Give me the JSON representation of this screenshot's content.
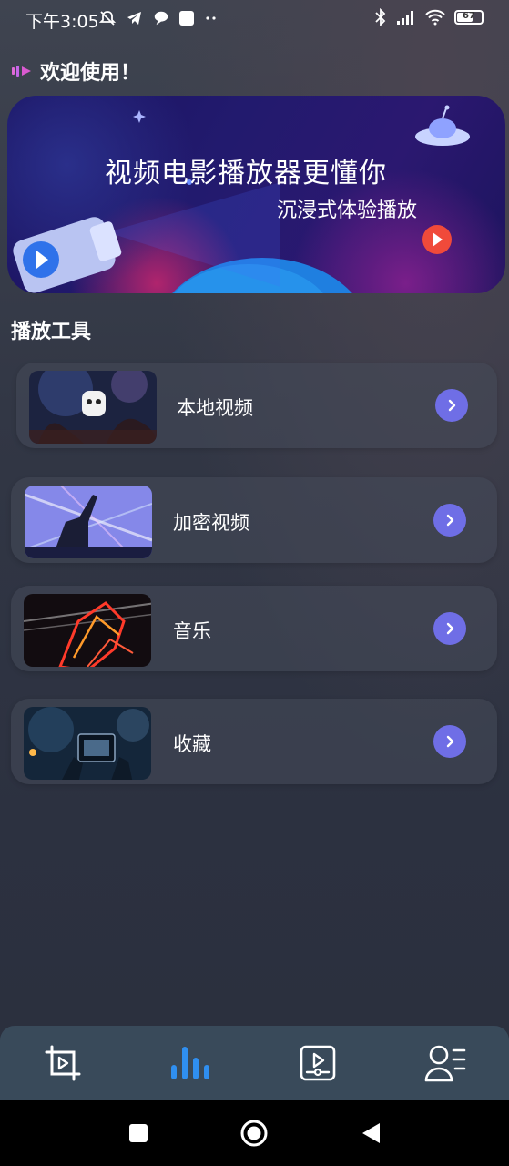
{
  "status_bar": {
    "time": "下午3:05",
    "left_icons": [
      "mute-bell-icon",
      "telegram-icon",
      "chat-icon",
      "square-app-icon",
      "more-dots-icon"
    ],
    "right_icons": [
      "bluetooth-icon",
      "signal-icon",
      "wifi-icon",
      "battery-icon"
    ],
    "battery_level": "67"
  },
  "header": {
    "welcome_text": "欢迎使用！",
    "welcome_icon": "speaker-wave-icon"
  },
  "banner": {
    "title": "视频电影播放器更懂你",
    "subtitle": "沉浸式体验播放"
  },
  "section": {
    "title": "播放工具"
  },
  "tools": [
    {
      "label": "本地视频",
      "thumb": "concert-crowd"
    },
    {
      "label": "加密视频",
      "thumb": "concert-lights"
    },
    {
      "label": "音乐",
      "thumb": "guitar-neon"
    },
    {
      "label": "收藏",
      "thumb": "phone-recording"
    }
  ],
  "bottom_nav": {
    "items": [
      {
        "name": "crop",
        "icon": "crop-play-icon",
        "active": false
      },
      {
        "name": "equalizer",
        "icon": "equalizer-bars-icon",
        "active": true
      },
      {
        "name": "video",
        "icon": "video-player-icon",
        "active": false
      },
      {
        "name": "profile",
        "icon": "user-list-icon",
        "active": false
      }
    ],
    "active_color": "#2f8ff0"
  },
  "colors": {
    "arrow_button": "#6f6ee6",
    "card_bg": "#464b5a"
  }
}
